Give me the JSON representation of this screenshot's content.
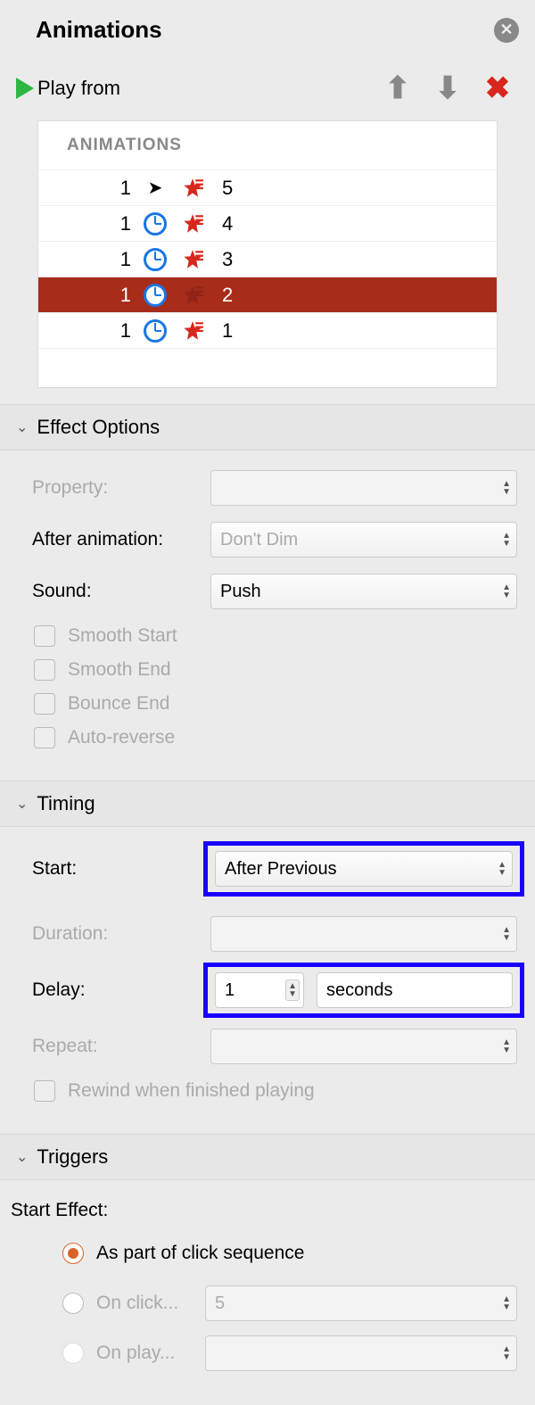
{
  "header": {
    "title": "Animations"
  },
  "toolbar": {
    "play_label": "Play from"
  },
  "list": {
    "header": "ANIMATIONS",
    "rows": [
      {
        "order": "1",
        "trigger": "click",
        "label": "5",
        "selected": false
      },
      {
        "order": "1",
        "trigger": "clock",
        "label": "4",
        "selected": false
      },
      {
        "order": "1",
        "trigger": "clock",
        "label": "3",
        "selected": false
      },
      {
        "order": "1",
        "trigger": "clock",
        "label": "2",
        "selected": true
      },
      {
        "order": "1",
        "trigger": "clock",
        "label": "1",
        "selected": false
      }
    ]
  },
  "sections": {
    "effect_options": "Effect Options",
    "timing": "Timing",
    "triggers": "Triggers"
  },
  "effect": {
    "property_label": "Property:",
    "after_anim_label": "After animation:",
    "after_anim_value": "Don't Dim",
    "sound_label": "Sound:",
    "sound_value": "Push",
    "smooth_start": "Smooth Start",
    "smooth_end": "Smooth End",
    "bounce_end": "Bounce End",
    "auto_reverse": "Auto-reverse"
  },
  "timing": {
    "start_label": "Start:",
    "start_value": "After Previous",
    "duration_label": "Duration:",
    "delay_label": "Delay:",
    "delay_value": "1",
    "delay_unit": "seconds",
    "repeat_label": "Repeat:",
    "rewind_label": "Rewind when finished playing"
  },
  "triggers": {
    "start_effect_label": "Start Effect:",
    "opt_sequence": "As part of click sequence",
    "opt_onclick": "On click...",
    "opt_onclick_value": "5",
    "opt_onplay": "On play..."
  }
}
